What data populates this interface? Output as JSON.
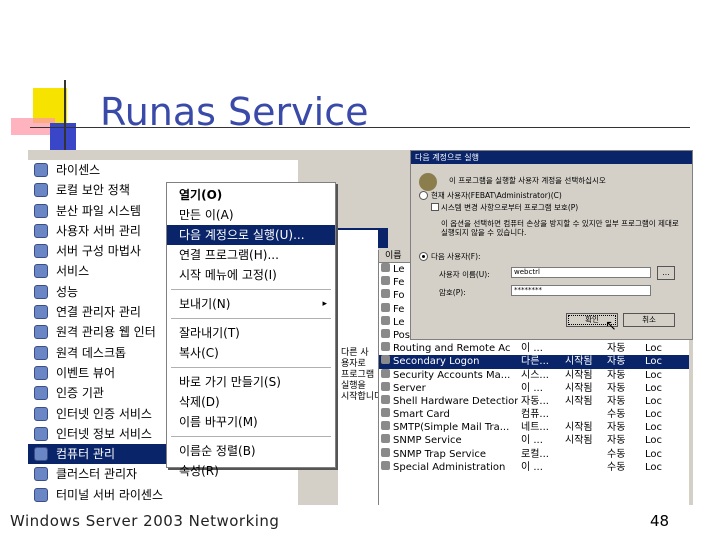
{
  "slide": {
    "title": "Runas Service",
    "footer_left": "Windows  Server 2003 Networking",
    "footer_right": "48"
  },
  "start_menu": {
    "items": [
      {
        "label": "라이센스",
        "icon": "license-icon"
      },
      {
        "label": "로컬 보안 정책",
        "icon": "security-policy-icon"
      },
      {
        "label": "분산 파일 시스템",
        "icon": "dfs-icon"
      },
      {
        "label": "사용자 서버 관리",
        "icon": "server-manage-icon"
      },
      {
        "label": "서버 구성 마법사",
        "icon": "wizard-icon"
      },
      {
        "label": "서비스",
        "icon": "services-gear-icon"
      },
      {
        "label": "성능",
        "icon": "performance-icon"
      },
      {
        "label": "연결 관리자 관리 ",
        "icon": "connection-manager-icon"
      },
      {
        "label": "원격 관리용 웹 인터",
        "icon": "web-admin-icon"
      },
      {
        "label": "원격 데스크톱",
        "icon": "remote-desktop-icon"
      },
      {
        "label": "이벤트 뷰어",
        "icon": "event-viewer-icon"
      },
      {
        "label": "인증 기관",
        "icon": "certificate-authority-icon"
      },
      {
        "label": "인터넷 인증 서비스",
        "icon": "ias-icon"
      },
      {
        "label": "인터넷 정보 서비스",
        "icon": "iis-icon"
      },
      {
        "label": "컴퓨터 관리",
        "icon": "computer-management-icon",
        "selected": true
      },
      {
        "label": "클러스터 관리자",
        "icon": "cluster-icon"
      },
      {
        "label": "터미널 서버 라이센스",
        "icon": "terminal-license-icon"
      }
    ]
  },
  "context_menu": {
    "groups": [
      [
        {
          "label": "열기(O)",
          "bold": true
        },
        {
          "label": "만든 이(A)"
        },
        {
          "label": "다음 계정으로 실행(U)...",
          "highlight": true
        },
        {
          "label": "연결 프로그램(H)..."
        },
        {
          "label": "시작 메뉴에 고정(I)"
        }
      ],
      [
        {
          "label": "보내기(N)",
          "submenu": "▸"
        }
      ],
      [
        {
          "label": "잘라내기(T)"
        },
        {
          "label": "복사(C)"
        }
      ],
      [
        {
          "label": "바로 가기 만들기(S)"
        },
        {
          "label": "삭제(D)"
        },
        {
          "label": "이름 바꾸기(M)"
        }
      ],
      [
        {
          "label": "이름순 정렬(B)"
        },
        {
          "label": "속성(R)"
        }
      ]
    ]
  },
  "dialog": {
    "title": "다음 계정으로 실행",
    "question": "이 프로그램을 실행할 사용자 계정을 선택하십시오",
    "option_current": "현재 사용자(FEBAT\\Administrator)(C)",
    "option_protect": "시스템 변경 사항으로부터 프로그램 보호(P)",
    "option_protect_desc": "이 옵션을 선택하면 컴퓨터 손상을 방지할 수 있지만 일부 프로그램이 제대로 실행되지 않을 수 있습니다.",
    "option_other": "다음 사용자(F):",
    "user_label": "사용자 이름(U):",
    "user_value": "webctrl",
    "password_label": "암호(P):",
    "password_value": "********",
    "ok_label": "확인",
    "cancel_label": "취소"
  },
  "services_list": {
    "header": "이름",
    "rows": [
      {
        "name": "Le",
        "desc": "",
        "status": "",
        "type": "",
        "logon": ""
      },
      {
        "name": "Fe",
        "desc": "",
        "status": "",
        "type": "",
        "logon": ""
      },
      {
        "name": "Fo",
        "desc": "",
        "status": "",
        "type": "",
        "logon": ""
      },
      {
        "name": "Fe",
        "desc": "",
        "status": "",
        "type": "",
        "logon": ""
      },
      {
        "name": "Le",
        "desc": "",
        "status": "",
        "type": "",
        "logon": ""
      },
      {
        "name": "Pos",
        "desc": "",
        "status": "",
        "type": "",
        "logon": ""
      },
      {
        "name": "Routing and Remote Ac",
        "desc": "이 ...",
        "status": "",
        "type": "자동",
        "logon": "Loc"
      },
      {
        "name": "Secondary Logon",
        "desc": "다른...",
        "status": "시작됨",
        "type": "자동",
        "logon": "Loc",
        "selected": true
      },
      {
        "name": "Security Accounts Ma...",
        "desc": "시스...",
        "status": "시작됨",
        "type": "자동",
        "logon": "Loc"
      },
      {
        "name": "Server",
        "desc": "이 ...",
        "status": "시작됨",
        "type": "자동",
        "logon": "Loc"
      },
      {
        "name": "Shell Hardware Detection",
        "desc": "자동...",
        "status": "시작됨",
        "type": "자동",
        "logon": "Loc"
      },
      {
        "name": "Smart Card",
        "desc": "컴퓨...",
        "status": "",
        "type": "수동",
        "logon": "Loc"
      },
      {
        "name": "SMTP(Simple Mail Tra...",
        "desc": "네트...",
        "status": "시작됨",
        "type": "자동",
        "logon": "Loc"
      },
      {
        "name": "SNMP Service",
        "desc": "이 ...",
        "status": "시작됨",
        "type": "자동",
        "logon": "Loc"
      },
      {
        "name": "SNMP Trap Service",
        "desc": "로컬...",
        "status": "",
        "type": "수동",
        "logon": "Loc"
      },
      {
        "name": "Special Administration",
        "desc": "이 ...",
        "status": "",
        "type": "수동",
        "logon": "Loc"
      }
    ]
  },
  "side_text": "다른 사\n용자로\n프로그램\n실행을\n시작합니다",
  "colors": {
    "title": "#3a4aa8",
    "selection": "#0a246a",
    "window_bg": "#d4d0c8"
  }
}
